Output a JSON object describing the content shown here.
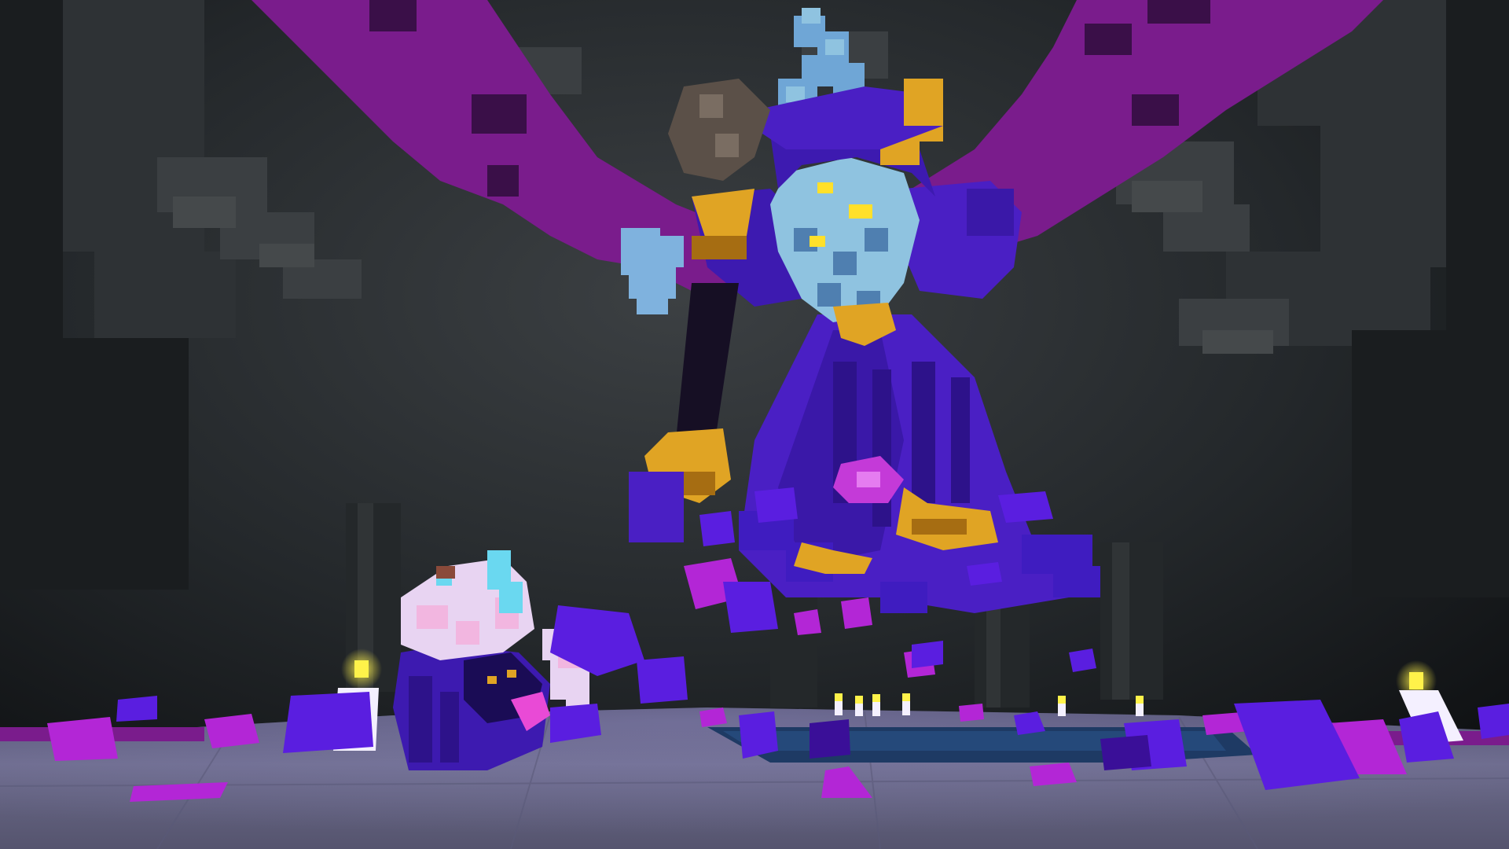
{
  "scene": {
    "subject": "voxel-boss-battle",
    "palette": {
      "cave_dark": "#14171a",
      "cave_mid": "#2a2e31",
      "cave_light": "#474b4d",
      "cave_shadow": "#0e1012",
      "wing_magenta": "#7a1c8c",
      "wing_dark": "#3a0f48",
      "robe_purple": "#4a1fc4",
      "robe_deep": "#2d128a",
      "robe_dark": "#1a0c55",
      "skin_blue": "#8fc3e0",
      "skin_blue_dark": "#4f7fb0",
      "horn_blue": "#6fa6d6",
      "gold": "#e0a424",
      "gold_dark": "#a66d12",
      "eye_glow": "#ffe02a",
      "club_stone": "#5b5048",
      "staff_dark": "#160f24",
      "debris_magenta": "#b326d6",
      "debris_purple": "#5a1ee0",
      "floor_lilac": "#6b6a8a",
      "floor_light": "#8a88a6",
      "pool_teal": "#1e3a64",
      "candle_white": "#f4f0ff",
      "candle_flame": "#fff24a",
      "hero_white": "#e8d4f2",
      "hero_pink": "#f2b6e0",
      "hero_cyan": "#6ad8f0",
      "hero_robe": "#3d1ab0"
    },
    "icons": [
      "boss-sprite",
      "player-character",
      "wing",
      "club-staff",
      "crystal-debris",
      "candle"
    ]
  }
}
